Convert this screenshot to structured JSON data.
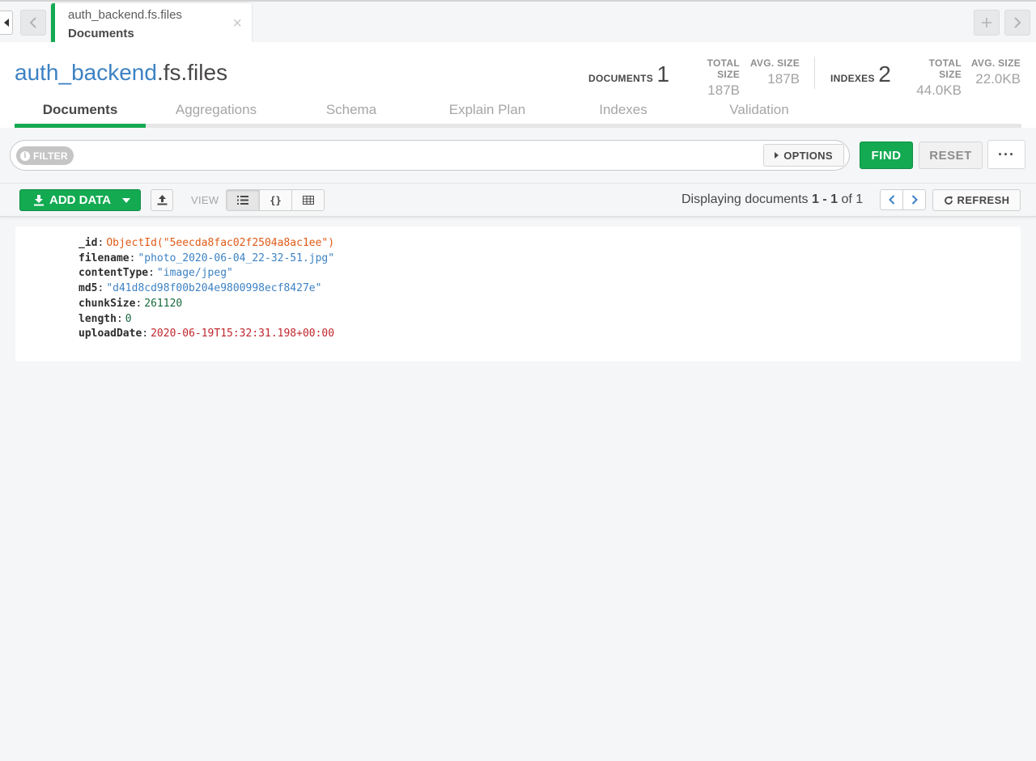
{
  "tab": {
    "namespace": "auth_backend.fs.files",
    "subtitle": "Documents",
    "close_glyph": "×"
  },
  "header": {
    "db_name": "auth_backend",
    "collection_suffix": ".fs.files",
    "documents_label": "DOCUMENTS",
    "documents_count": "1",
    "docs_total_size_label": "TOTAL SIZE",
    "docs_total_size": "187B",
    "docs_avg_size_label": "AVG. SIZE",
    "docs_avg_size": "187B",
    "indexes_label": "INDEXES",
    "indexes_count": "2",
    "idx_total_size_label": "TOTAL SIZE",
    "idx_total_size": "44.0KB",
    "idx_avg_size_label": "AVG. SIZE",
    "idx_avg_size": "22.0KB"
  },
  "nav_tabs": [
    "Documents",
    "Aggregations",
    "Schema",
    "Explain Plan",
    "Indexes",
    "Validation"
  ],
  "filter": {
    "chip_label": "FILTER",
    "chip_icon": "i",
    "value": "",
    "options_label": "OPTIONS",
    "find_label": "FIND",
    "reset_label": "RESET",
    "more_label": "···"
  },
  "toolbar": {
    "add_data_label": "ADD DATA",
    "view_label": "VIEW",
    "view_json_glyph": "{}",
    "display_prefix": "Displaying documents",
    "display_range": "1 - 1",
    "display_of": "of 1",
    "refresh_label": "REFRESH"
  },
  "document": {
    "fields": [
      {
        "key": "_id",
        "value": "ObjectId(\"5eecda8fac02f2504a8ac1ee\")"
      },
      {
        "key": "filename",
        "value": "\"photo_2020-06-04_22-32-51.jpg\""
      },
      {
        "key": "contentType",
        "value": "\"image/jpeg\""
      },
      {
        "key": "md5",
        "value": "\"d41d8cd98f00b204e9800998ecf8427e\""
      },
      {
        "key": "chunkSize",
        "value": "261120"
      },
      {
        "key": "length",
        "value": "0"
      },
      {
        "key": "uploadDate",
        "value": "2020-06-19T15:32:31.198+00:00"
      }
    ]
  },
  "colors": {
    "accent_green": "#13aa52",
    "db_blue": "#3d82c3",
    "objectid_orange": "#e05a17",
    "string_blue": "#3d82c3",
    "number_green": "#1a6b3d",
    "date_red": "#c0262d"
  }
}
